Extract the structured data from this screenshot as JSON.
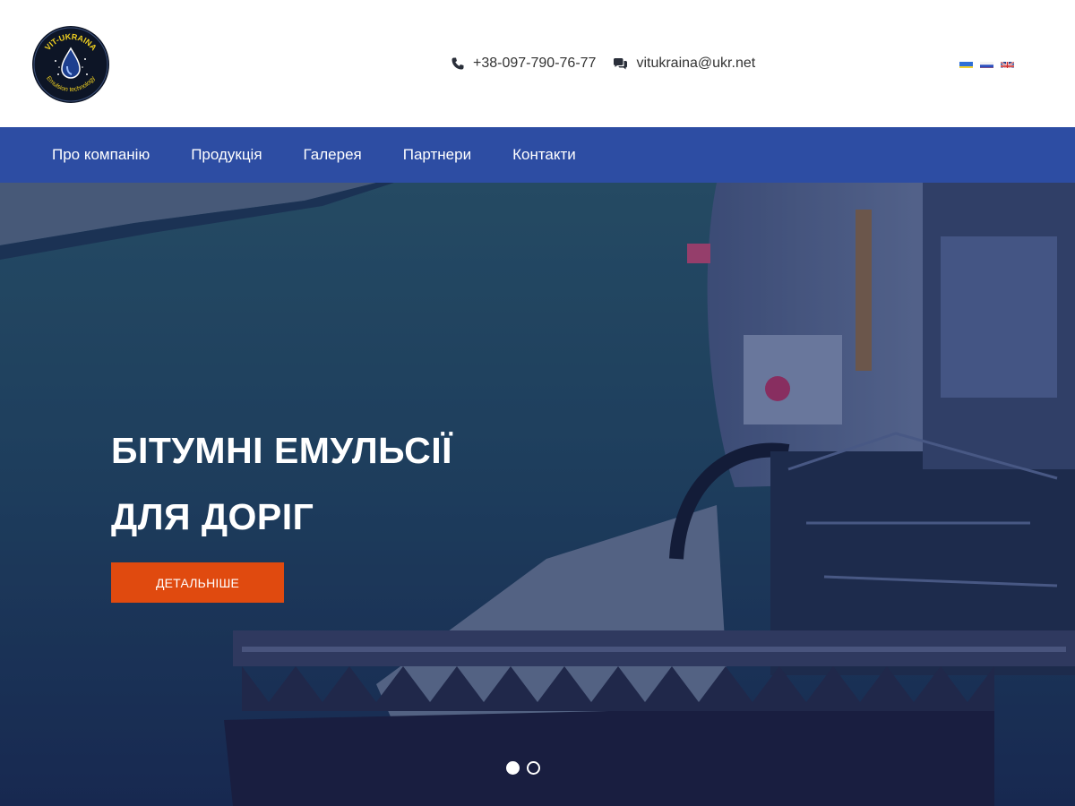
{
  "header": {
    "logo": {
      "top_text": "VIT-UKRAINA",
      "bottom_text": "Emulsion technology"
    },
    "phone": "+38-097-790-76-77",
    "email": "vitukraina@ukr.net",
    "languages": [
      "uk",
      "ru",
      "en"
    ]
  },
  "nav": {
    "items": [
      {
        "label": "Про компанію"
      },
      {
        "label": "Продукція"
      },
      {
        "label": "Галерея"
      },
      {
        "label": "Партнери"
      },
      {
        "label": "Контакти"
      }
    ]
  },
  "hero": {
    "title_line1": "БІТУМНІ ЕМУЛЬСІЇ",
    "title_line2": "ДЛЯ ДОРІГ",
    "button_label": "ДЕТАЛЬНІШЕ",
    "slides_total": 2,
    "active_slide": 1
  },
  "colors": {
    "nav_bg": "#2d4da3",
    "button_bg": "#e04a0f",
    "hero_overlay": "#1b2a55"
  }
}
